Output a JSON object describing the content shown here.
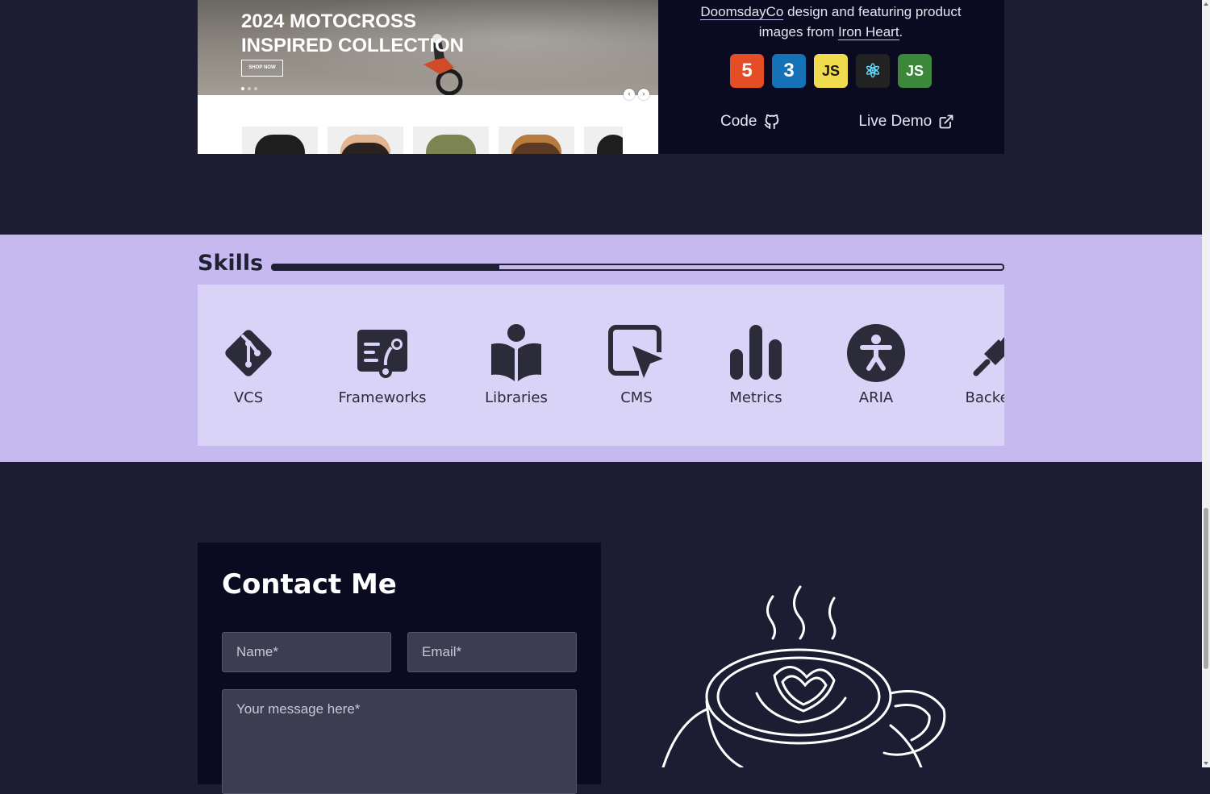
{
  "project": {
    "hero_title": "2024 MOTOCROSS INSPIRED COLLECTION",
    "hero_button": "SHOP NOW",
    "carousel_prev": "‹",
    "carousel_next": "›",
    "description_link_1": "DoomsdayCo",
    "description_mid": " design and featuring product images from ",
    "description_link_2": "Iron Heart",
    "description_end": ".",
    "tech": [
      {
        "name": "html5-icon",
        "label": "5",
        "bg": "#e44d26",
        "fg": "#ffffff"
      },
      {
        "name": "css3-icon",
        "label": "3",
        "bg": "#1572b6",
        "fg": "#ffffff"
      },
      {
        "name": "javascript-icon",
        "label": "JS",
        "bg": "#f0db4f",
        "fg": "#1a1a1a"
      },
      {
        "name": "react-icon",
        "label": "⚛",
        "bg": "#222222",
        "fg": "#61dafb"
      },
      {
        "name": "nodejs-icon",
        "label": "JS",
        "bg": "#3c873a",
        "fg": "#ffffff"
      }
    ],
    "code_label": "Code",
    "live_demo_label": "Live Demo"
  },
  "skills": {
    "heading": "Skills",
    "progress_fraction": 0.31,
    "items": [
      {
        "label": "VCS",
        "icon": "git-icon"
      },
      {
        "label": "Frameworks",
        "icon": "frameworks-icon"
      },
      {
        "label": "Libraries",
        "icon": "book-reader-icon"
      },
      {
        "label": "CMS",
        "icon": "cursor-window-icon"
      },
      {
        "label": "Metrics",
        "icon": "bar-chart-icon"
      },
      {
        "label": "ARIA",
        "icon": "accessibility-icon"
      },
      {
        "label": "Backend",
        "icon": "plug-icon"
      }
    ]
  },
  "contact": {
    "title": "Contact Me",
    "name_placeholder": "Name*",
    "email_placeholder": "Email*",
    "message_placeholder": "Your message here*"
  },
  "colors": {
    "page_bg": "#1c1c33",
    "card_bg": "#0a0a20",
    "skills_bg": "#c5b9ef",
    "skills_track_bg": "#d9d3f7",
    "accent": "#c9c3f0"
  }
}
